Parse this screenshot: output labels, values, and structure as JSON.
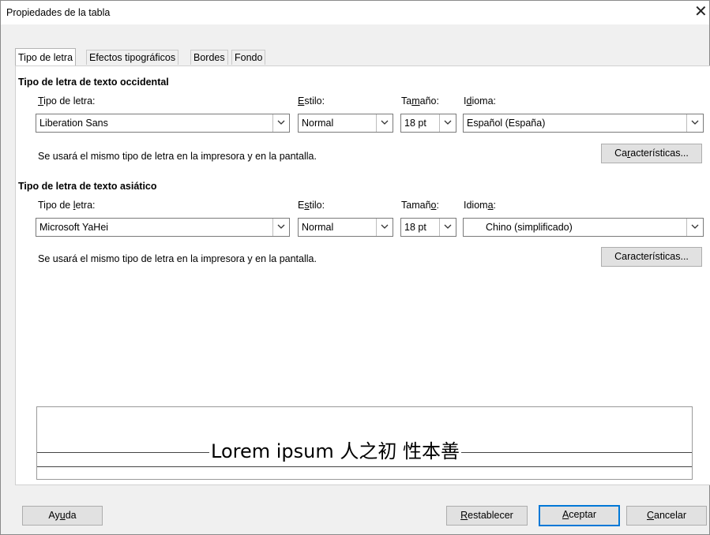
{
  "window": {
    "title": "Propiedades de la tabla"
  },
  "tabs": [
    {
      "label": "Tipo de letra",
      "active": true
    },
    {
      "label": "Efectos tipográficos",
      "active": false
    },
    {
      "label": "Bordes",
      "active": false
    },
    {
      "label": "Fondo",
      "active": false
    }
  ],
  "western": {
    "heading": "Tipo de letra de texto occidental",
    "font_label_pre": "",
    "font_label_u": "T",
    "font_label_post": "ipo de letra:",
    "style_label_u": "E",
    "style_label_post": "stilo:",
    "size_label_pre": "Ta",
    "size_label_u": "m",
    "size_label_post": "año:",
    "lang_label_pre": "I",
    "lang_label_u": "d",
    "lang_label_post": "ioma:",
    "font_value": "Liberation Sans",
    "style_value": "Normal",
    "size_value": "18 pt",
    "lang_value": "Español (España)",
    "note": "Se usará el mismo tipo de letra en la impresora y en la pantalla.",
    "features_pre": "Ca",
    "features_u": "r",
    "features_post": "acterísticas..."
  },
  "asian": {
    "heading": "Tipo de letra de texto asiático",
    "font_label_pre": "Tipo de ",
    "font_label_u": "l",
    "font_label_post": "etra:",
    "style_label_pre": "E",
    "style_label_u": "s",
    "style_label_post": "tilo:",
    "size_label_pre": "Tamañ",
    "size_label_u": "o",
    "size_label_post": ":",
    "lang_label_pre": "Idiom",
    "lang_label_u": "a",
    "lang_label_post": ":",
    "font_value": "Microsoft YaHei",
    "style_value": "Normal",
    "size_value": "18 pt",
    "lang_value": "Chino (simplificado)",
    "note": "Se usará el mismo tipo de letra en la impresora y en la pantalla.",
    "features_label": "Características..."
  },
  "preview": {
    "text": "Lorem ipsum 人之初 性本善"
  },
  "buttons": {
    "help_pre": "Ay",
    "help_u": "u",
    "help_post": "da",
    "reset_u": "R",
    "reset_post": "establecer",
    "ok_u": "A",
    "ok_post": "ceptar",
    "cancel_u": "C",
    "cancel_post": "ancelar"
  },
  "colors": {
    "default_button_border": "#0078d7",
    "panel_bg": "#ffffff",
    "dialog_bg": "#f0f0f0"
  },
  "icons": {
    "dropdown": "chevron-down-icon",
    "close": "close-icon"
  }
}
